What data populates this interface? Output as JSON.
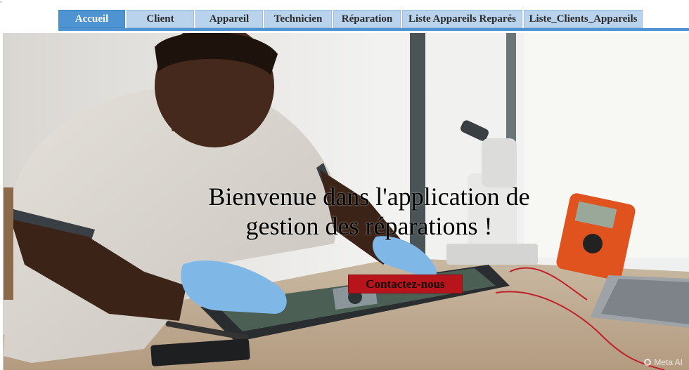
{
  "nav": {
    "tabs": [
      {
        "label": "Accueil",
        "active": true
      },
      {
        "label": "Client",
        "active": false
      },
      {
        "label": "Appareil",
        "active": false
      },
      {
        "label": "Technicien",
        "active": false
      },
      {
        "label": "Réparation",
        "active": false
      },
      {
        "label": "Liste Appareils Reparés",
        "active": false
      },
      {
        "label": "Liste_Clients_Appareils",
        "active": false
      }
    ]
  },
  "hero": {
    "line1": "Bienvenue dans l'application de",
    "line2": "gestion des réparations !",
    "contact_label": "Contactez-nous",
    "watermark": "Meta AI",
    "image_subject": "technician repairing a laptop motherboard with a microscope and multimeter"
  },
  "colors": {
    "nav_active": "#4e94d2",
    "nav_inactive": "#b9d3ec",
    "button": "#b7141c"
  }
}
